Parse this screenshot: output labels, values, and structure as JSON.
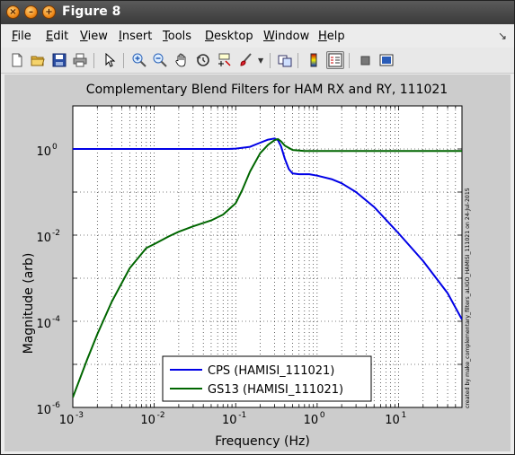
{
  "window": {
    "title": "Figure 8"
  },
  "menu": [
    {
      "key": "F",
      "rest": "ile"
    },
    {
      "key": "E",
      "rest": "dit"
    },
    {
      "key": "V",
      "rest": "iew"
    },
    {
      "key": "I",
      "rest": "nsert"
    },
    {
      "key": "T",
      "rest": "ools"
    },
    {
      "key": "D",
      "rest": "esktop"
    },
    {
      "key": "W",
      "rest": "indow"
    },
    {
      "key": "H",
      "rest": "elp"
    }
  ],
  "toolbar": [
    "new-file-icon",
    "open-folder-icon",
    "save-icon",
    "print-icon",
    "pointer-icon",
    "zoom-in-icon",
    "zoom-out-icon",
    "pan-hand-icon",
    "rotate-3d-icon",
    "data-cursor-icon",
    "brush-icon",
    "link-plot-icon",
    "colorbar-icon",
    "legend-icon",
    "hide-plot-tools-icon",
    "show-plot-tools-icon"
  ],
  "chart_data": {
    "type": "line",
    "title": "Complementary Blend Filters for HAM RX and RY, 111021",
    "xlabel": "Frequency (Hz)",
    "ylabel": "Magnitude (arb)",
    "xscale": "log",
    "yscale": "log",
    "xlim": [
      0.001,
      60
    ],
    "ylim": [
      1e-06,
      10
    ],
    "grid": true,
    "x_ticks": [
      {
        "base": "10",
        "exp": "-3"
      },
      {
        "base": "10",
        "exp": "-2"
      },
      {
        "base": "10",
        "exp": "-1"
      },
      {
        "base": "10",
        "exp": "0"
      },
      {
        "base": "10",
        "exp": "1"
      }
    ],
    "y_ticks": [
      {
        "base": "10",
        "exp": "-6"
      },
      {
        "base": "10",
        "exp": "-4"
      },
      {
        "base": "10",
        "exp": "-2"
      },
      {
        "base": "10",
        "exp": "0"
      }
    ],
    "legend_position": "bottom-center",
    "side_annotation": "created by make_complementary_filters_aLIGO_HAMISI_111021 on 24-Jul-2015",
    "series": [
      {
        "name": "CPS (HAMISI_111021)",
        "color": "#0000e6",
        "x": [
          0.001,
          0.01,
          0.05,
          0.08,
          0.1,
          0.15,
          0.2,
          0.25,
          0.3,
          0.33,
          0.36,
          0.4,
          0.45,
          0.5,
          0.6,
          0.8,
          1,
          1.5,
          2,
          3,
          5,
          10,
          20,
          40,
          60
        ],
        "y": [
          1,
          1,
          1,
          1,
          1.02,
          1.12,
          1.4,
          1.65,
          1.75,
          1.6,
          1.15,
          0.6,
          0.34,
          0.27,
          0.26,
          0.26,
          0.24,
          0.2,
          0.16,
          0.1,
          0.045,
          0.011,
          0.0025,
          0.00045,
          0.00011
        ]
      },
      {
        "name": "GS13 (HAMISI_111021)",
        "color": "#006600",
        "x": [
          0.001,
          0.0015,
          0.002,
          0.003,
          0.005,
          0.008,
          0.01,
          0.015,
          0.02,
          0.03,
          0.05,
          0.07,
          0.1,
          0.12,
          0.15,
          0.2,
          0.25,
          0.3,
          0.33,
          0.36,
          0.4,
          0.5,
          0.7,
          1,
          2,
          5,
          10,
          30,
          60
        ],
        "y": [
          1.7e-06,
          1.3e-05,
          5e-05,
          0.00028,
          0.0017,
          0.005,
          0.0062,
          0.0093,
          0.012,
          0.016,
          0.022,
          0.03,
          0.055,
          0.11,
          0.3,
          0.8,
          1.25,
          1.6,
          1.7,
          1.5,
          1.2,
          0.95,
          0.9,
          0.9,
          0.9,
          0.9,
          0.9,
          0.9,
          0.9
        ]
      }
    ]
  }
}
